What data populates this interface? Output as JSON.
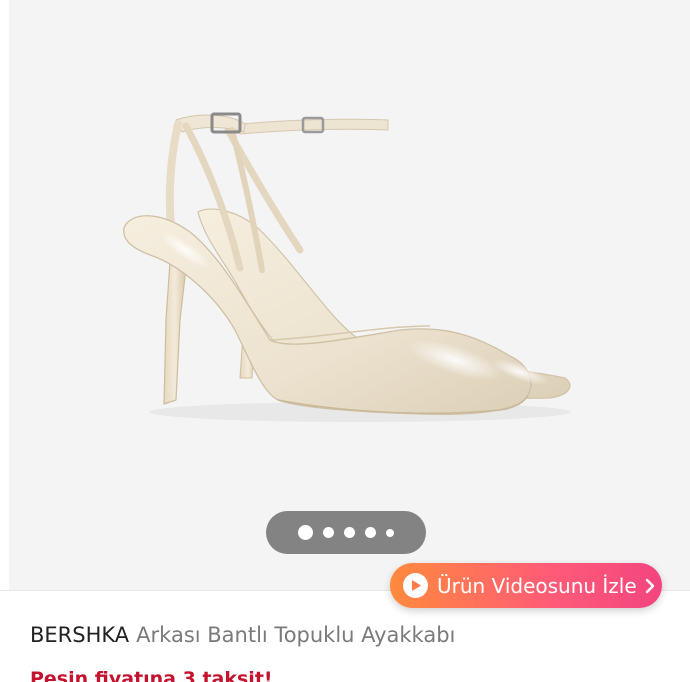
{
  "gallery": {
    "image_alt": "product-shoe-image",
    "pager": {
      "total": 5,
      "active_index": 0
    }
  },
  "video_button": {
    "label": "Ürün Videosunu İzle",
    "icon": "play-icon",
    "chevron": "chevron-right-icon",
    "gradient_start": "#ff8a3d",
    "gradient_end": "#f2457f"
  },
  "product": {
    "brand": "BERSHKA",
    "name": "Arkası Bantlı Topuklu Ayakkabı",
    "promo_text": "Peşin fiyatına 3 taksit!",
    "promo_color": "#c4132f"
  }
}
